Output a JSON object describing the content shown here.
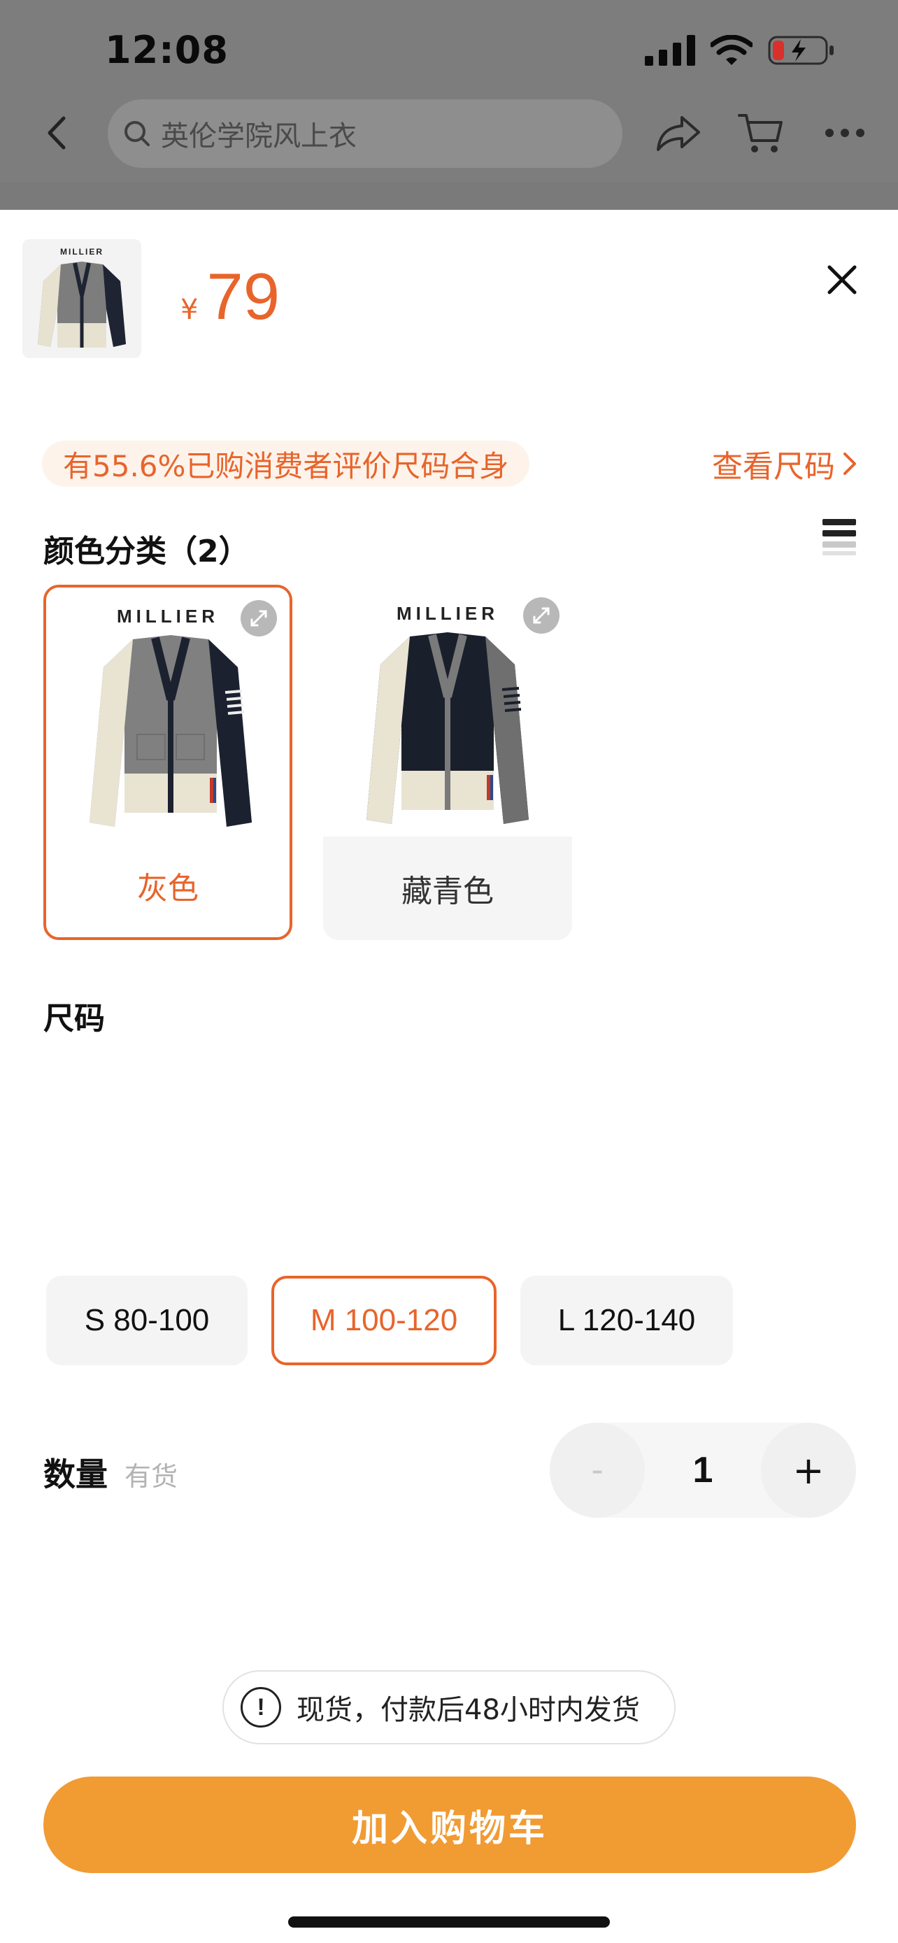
{
  "status_bar": {
    "time": "12:08"
  },
  "nav": {
    "search_placeholder": "英伦学院风上衣"
  },
  "product": {
    "thumb_brand": "MILLIER",
    "currency": "¥",
    "price": "79"
  },
  "fit": {
    "banner": "有55.6%已购消费者评价尺码合身",
    "size_link": "查看尺码"
  },
  "color_section": {
    "title": "颜色分类（2）",
    "options": [
      {
        "brand": "MILLIER",
        "label": "灰色",
        "selected": true
      },
      {
        "brand": "MILLIER",
        "label": "藏青色",
        "selected": false
      }
    ]
  },
  "size_section": {
    "title": "尺码",
    "options": [
      {
        "label": "S 80-100",
        "selected": false
      },
      {
        "label": "M 100-120",
        "selected": true
      },
      {
        "label": "L 120-140",
        "selected": false
      }
    ]
  },
  "quantity": {
    "label": "数量",
    "stock": "有货",
    "minus": "-",
    "value": "1",
    "plus": "+"
  },
  "shipping_note": {
    "icon_text": "!",
    "text": "现货，付款后48小时内发货"
  },
  "add_to_cart": "加入购物车",
  "colors": {
    "accent": "#e8642b",
    "cta": "#f19b33"
  }
}
